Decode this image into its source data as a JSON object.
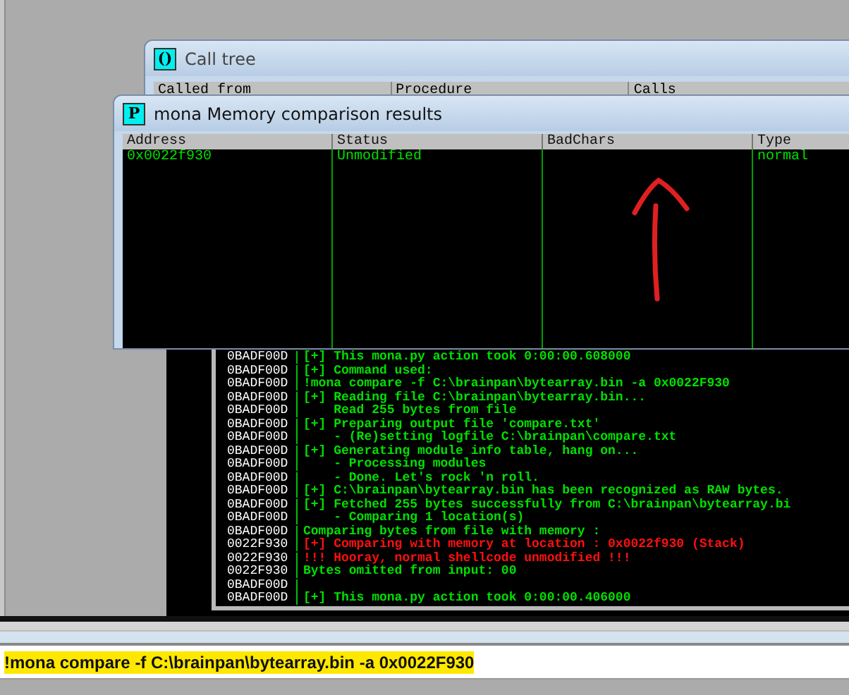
{
  "call_tree": {
    "title": "Call tree",
    "icon_label": "()",
    "columns": [
      "Called from",
      "Procedure",
      "Calls"
    ]
  },
  "mona_window": {
    "title": "mona Memory comparison results",
    "icon_label": "P",
    "columns": [
      "Address",
      "Status",
      "BadChars",
      "Type"
    ],
    "rows": [
      {
        "address": "0x0022f930",
        "status": "Unmodified",
        "type": "normal"
      }
    ]
  },
  "log": {
    "lines": [
      {
        "address": "0BADF00D",
        "message": "[+] This mona.py action took 0:00:00.608000",
        "color": "#00e000"
      },
      {
        "address": "0BADF00D",
        "message": "[+] Command used:",
        "color": "#00e000"
      },
      {
        "address": "0BADF00D",
        "message": "!mona compare -f C:\\brainpan\\bytearray.bin -a 0x0022F930",
        "color": "#00e000"
      },
      {
        "address": "0BADF00D",
        "message": "[+] Reading file C:\\brainpan\\bytearray.bin...",
        "color": "#00e000"
      },
      {
        "address": "0BADF00D",
        "message": "    Read 255 bytes from file",
        "color": "#00e000"
      },
      {
        "address": "0BADF00D",
        "message": "[+] Preparing output file 'compare.txt'",
        "color": "#00e000"
      },
      {
        "address": "0BADF00D",
        "message": "    - (Re)setting logfile C:\\brainpan\\compare.txt",
        "color": "#00e000"
      },
      {
        "address": "0BADF00D",
        "message": "[+] Generating module info table, hang on...",
        "color": "#00e000"
      },
      {
        "address": "0BADF00D",
        "message": "    - Processing modules",
        "color": "#00e000"
      },
      {
        "address": "0BADF00D",
        "message": "    - Done. Let's rock 'n roll.",
        "color": "#00e000"
      },
      {
        "address": "0BADF00D",
        "message": "[+] C:\\brainpan\\bytearray.bin has been recognized as RAW bytes.",
        "color": "#00e000"
      },
      {
        "address": "0BADF00D",
        "message": "[+] Fetched 255 bytes successfully from C:\\brainpan\\bytearray.bi",
        "color": "#00e000"
      },
      {
        "address": "0BADF00D",
        "message": "    - Comparing 1 location(s)",
        "color": "#00e000"
      },
      {
        "address": "0BADF00D",
        "message": "Comparing bytes from file with memory :",
        "color": "#00e000"
      },
      {
        "address": "0022F930",
        "message": "[+] Comparing with memory at location : 0x0022f930 (Stack)",
        "color": "#ff1010"
      },
      {
        "address": "0022F930",
        "message": "!!! Hooray, normal shellcode unmodified !!!",
        "color": "#ff1010"
      },
      {
        "address": "0022F930",
        "message": "Bytes omitted from input: 00",
        "color": "#00e000"
      },
      {
        "address": "0BADF00D"
      },
      {
        "address": "0BADF00D",
        "message": "[+] This mona.py action took 0:00:00.406000",
        "color": "#00e000"
      }
    ]
  },
  "command_line": {
    "value": "!mona compare -f C:\\brainpan\\bytearray.bin -a 0x0022F930"
  }
}
